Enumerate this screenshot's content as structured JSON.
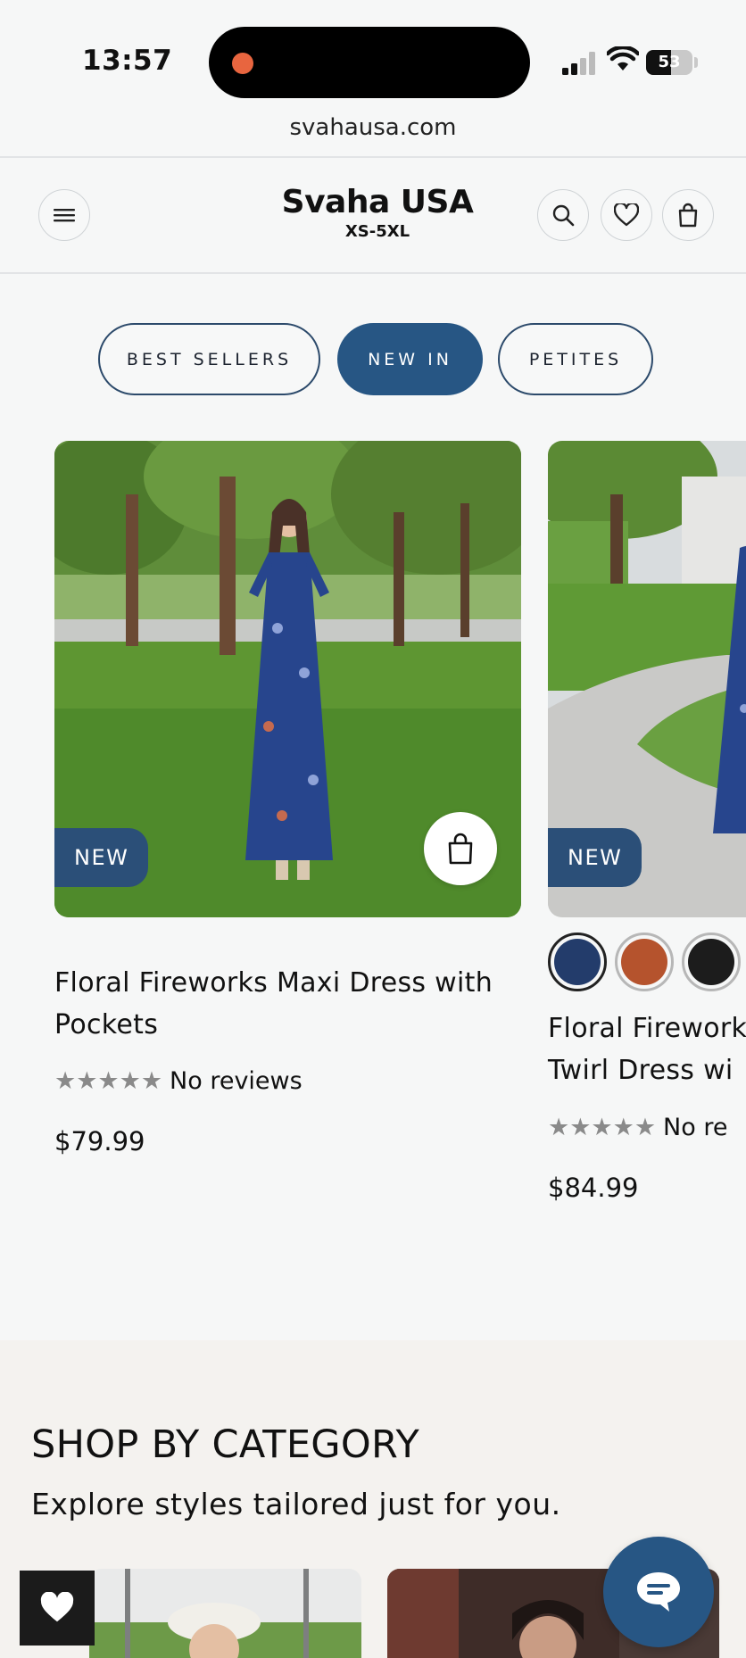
{
  "status_bar": {
    "time": "13:57",
    "battery": "53",
    "battery_level": 0.53
  },
  "browser": {
    "url": "svahausa.com"
  },
  "header": {
    "brand_name": "Svaha USA",
    "brand_sub": "XS-5XL",
    "icons": [
      "menu-icon",
      "search-icon",
      "heart-icon",
      "bag-icon"
    ]
  },
  "filters": [
    {
      "label": "BEST SELLERS",
      "active": false
    },
    {
      "label": "NEW IN",
      "active": true
    },
    {
      "label": "PETITES",
      "active": false
    }
  ],
  "products": [
    {
      "badge": "NEW",
      "title_line1": "Floral Fireworks Maxi Dress with",
      "title_line2": "Pockets",
      "stars": "★★★★★",
      "reviews": "No reviews",
      "price": "$79.99"
    },
    {
      "badge": "NEW",
      "title_line1": "Floral Firework",
      "title_line2": "Twirl Dress wi",
      "stars": "★★★★★",
      "reviews": "No re",
      "price": "$84.99",
      "swatches": [
        "#233c6b",
        "#b5532d",
        "#1c1c1c"
      ]
    }
  ],
  "category": {
    "title": "SHOP BY CATEGORY",
    "subtitle": "Explore styles tailored just for you."
  },
  "colors": {
    "accent": "#275684",
    "badge": "#2b4f78",
    "background": "#f6f7f7",
    "category_bg": "#f4f2ef"
  }
}
